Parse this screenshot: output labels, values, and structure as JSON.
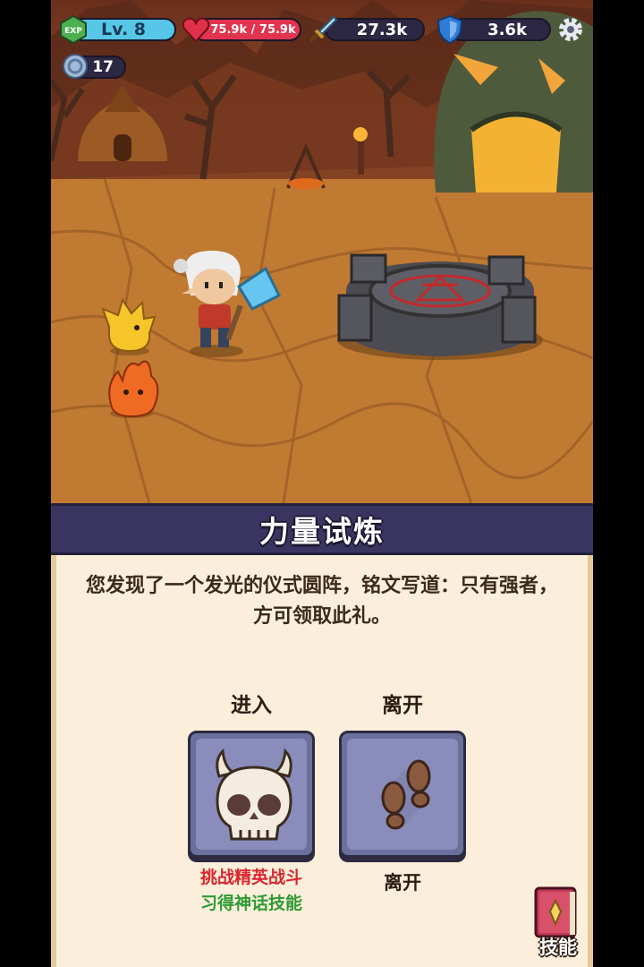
{
  "hud": {
    "exp_label": "EXP",
    "level": "Lv. 8",
    "hp": "75.9k / 75.9k",
    "attack": "27.3k",
    "defense": "3.6k",
    "coins": "17",
    "icons": [
      "exp-badge-icon",
      "heart-icon",
      "sword-icon",
      "shield-icon",
      "gear-icon",
      "coin-icon"
    ]
  },
  "event": {
    "title": "力量试炼",
    "description": "您发现了一个发光的仪式圆阵，铭文写道：只有强者，方可领取此礼。",
    "choices": [
      {
        "label": "进入",
        "icon": "horned-skull-icon",
        "effects": [
          "挑战精英战斗",
          "习得神话技能"
        ],
        "effect_colors": [
          "#d8262e",
          "#2f9a34"
        ]
      },
      {
        "label": "离开",
        "icon": "footprints-icon",
        "caption": "离开"
      }
    ]
  },
  "skills_button": {
    "label": "技能",
    "icon": "spellbook-icon"
  },
  "colors": {
    "panel_banner": "#3a3560",
    "parchment": "#fbefdb",
    "card": "#8a8dbb"
  }
}
